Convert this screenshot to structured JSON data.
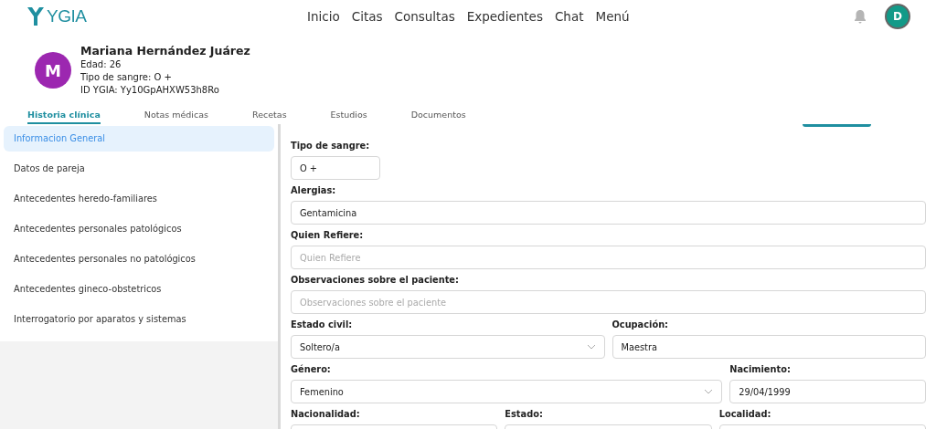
{
  "brand": "YGIA",
  "nav": [
    {
      "label": "Inicio"
    },
    {
      "label": "Citas"
    },
    {
      "label": "Consultas"
    },
    {
      "label": "Expedientes"
    },
    {
      "label": "Chat"
    },
    {
      "label": "Menú"
    }
  ],
  "user_avatar": "D",
  "patient": {
    "initial": "M",
    "name": "Mariana Hernández Juárez",
    "details": [
      "Edad: 26",
      "Tipo de sangre: O +",
      "ID YGIA: Yy10GpAHXW53h8Ro"
    ]
  },
  "tabs": [
    {
      "label": "Historia clínica",
      "selected": true
    },
    {
      "label": "Notas médicas",
      "selected": false
    },
    {
      "label": "Recetas",
      "selected": false
    },
    {
      "label": "Estudios",
      "selected": false
    },
    {
      "label": "Documentos",
      "selected": false
    }
  ],
  "sidebar": {
    "items": [
      {
        "label": "Informacion General",
        "selected": true
      },
      {
        "label": "Datos de pareja",
        "selected": false
      },
      {
        "label": "Antecedentes heredo-familiares",
        "selected": false
      },
      {
        "label": "Antecedentes personales patológicos",
        "selected": false
      },
      {
        "label": "Antecedentes personales no patológicos",
        "selected": false
      },
      {
        "label": "Antecedentes gineco-obstetricos",
        "selected": false
      },
      {
        "label": "Interrogatorio por aparatos y sistemas",
        "selected": false
      }
    ]
  },
  "form": {
    "fields": [
      {
        "label": "Tipo de sangre:",
        "kind": "compact",
        "value": "O +"
      },
      {
        "label": "Alergias:",
        "kind": "input",
        "value": "Gentamicina"
      },
      {
        "label": "Quien Refiere:",
        "kind": "input",
        "placeholder": "Quien Refiere"
      },
      {
        "label": "Observaciones sobre el paciente:",
        "kind": "input",
        "placeholder": "Observaciones sobre el paciente"
      },
      {
        "label": "Estado civil:",
        "kind": "select",
        "value": "Soltero/a"
      },
      {
        "label": "Ocupación:",
        "kind": "input",
        "value": "Maestra"
      },
      {
        "label": "Género:",
        "kind": "select",
        "value": "Femenino"
      },
      {
        "label": "Nacimiento:",
        "kind": "input",
        "value": "29/04/1999"
      },
      {
        "label": "Nacionalidad:",
        "kind": "input"
      },
      {
        "label": "Estado:",
        "kind": "input"
      },
      {
        "label": "Localidad:",
        "kind": "input"
      }
    ]
  }
}
